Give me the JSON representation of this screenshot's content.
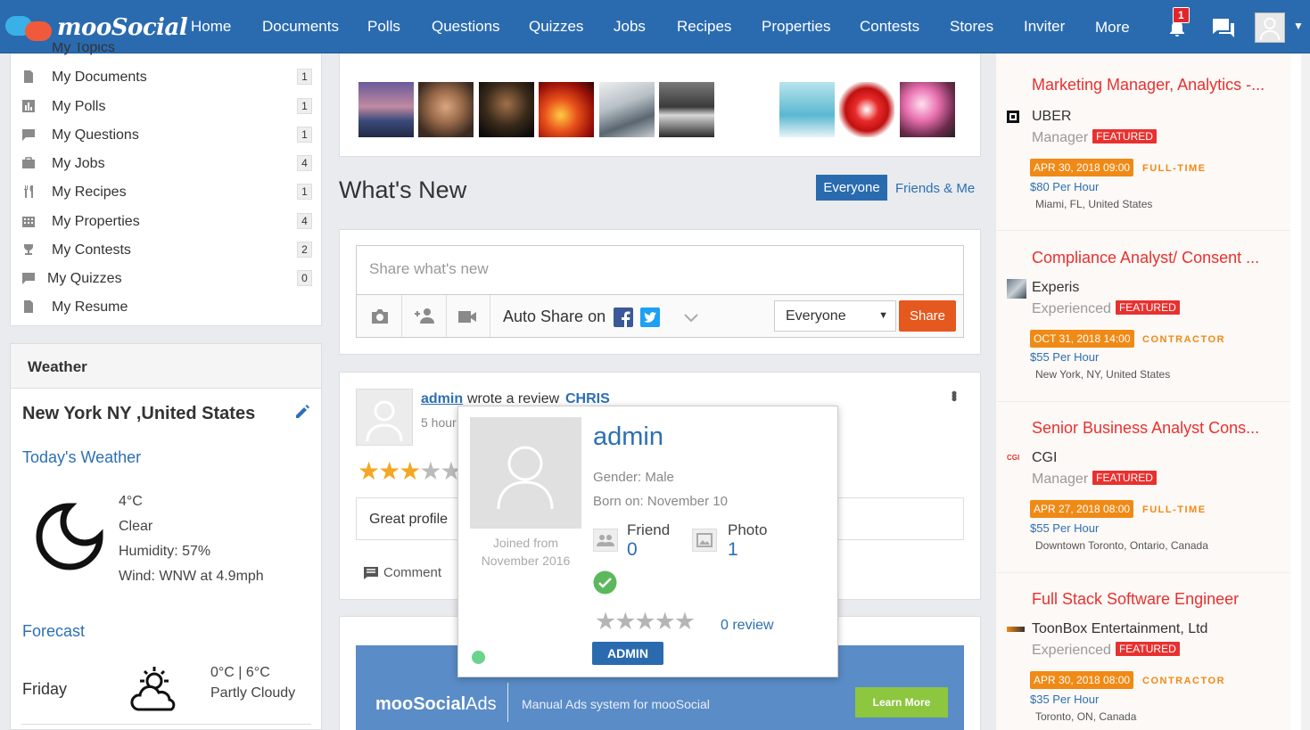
{
  "app": {
    "name": "mooSocial"
  },
  "nav": {
    "items": [
      "Home",
      "Documents",
      "Polls",
      "Questions",
      "Quizzes",
      "Jobs",
      "Recipes",
      "Properties",
      "Contests",
      "Stores",
      "Inviter",
      "More"
    ],
    "notification_count": "1"
  },
  "sidebar": {
    "partial_item": "My Topics",
    "items": [
      {
        "label": "My Documents",
        "count": "1",
        "icon": "document-icon"
      },
      {
        "label": "My Polls",
        "count": "1",
        "icon": "poll-icon"
      },
      {
        "label": "My Questions",
        "count": "1",
        "icon": "question-icon"
      },
      {
        "label": "My Jobs",
        "count": "4",
        "icon": "briefcase-icon"
      },
      {
        "label": "My Recipes",
        "count": "1",
        "icon": "fork-knife-icon"
      },
      {
        "label": "My Properties",
        "count": "4",
        "icon": "building-icon"
      },
      {
        "label": "My Contests",
        "count": "2",
        "icon": "trophy-icon"
      },
      {
        "label": "My Quizzes",
        "count": "0",
        "icon": "quiz-icon"
      },
      {
        "label": "My Resume",
        "count": "",
        "icon": "resume-icon"
      }
    ]
  },
  "weather": {
    "heading": "Weather",
    "location": "New York NY ,United States",
    "today_label": "Today's Weather",
    "temp": "4°C",
    "condition": "Clear",
    "humidity": "Humidity: 57%",
    "wind": "Wind: WNW at 4.9mph",
    "forecast_label": "Forecast",
    "forecast_day": "Friday",
    "forecast_temp": "0°C | 6°C",
    "forecast_condition": "Partly Cloudy"
  },
  "feed": {
    "title": "What's New",
    "tab_everyone": "Everyone",
    "tab_friends": "Friends & Me",
    "share_placeholder": "Share what's new",
    "auto_share": "Auto Share on",
    "privacy_value": "Everyone",
    "share_button": "Share",
    "post": {
      "author": "admin",
      "action": "wrote a review",
      "target": "CHRIS",
      "time": "5 hours ago",
      "rating": 3,
      "review_text": "Great profile",
      "comment_label": "Comment"
    },
    "ad": {
      "brand": "mooSocialAds",
      "brand_bold": "mooSocial",
      "brand_light": "Ads",
      "tagline": "Manual Ads system for mooSocial",
      "cta": "Learn More"
    }
  },
  "popup": {
    "name": "admin",
    "gender": "Gender: Male",
    "born": "Born on: November 10",
    "joined_line1": "Joined from",
    "joined_line2": "November 2016",
    "friend_label": "Friend",
    "friend_count": "0",
    "photo_label": "Photo",
    "photo_count": "1",
    "rating": 0,
    "review_label": "0 review",
    "role_badge": "ADMIN"
  },
  "jobs": [
    {
      "title": "Marketing Manager, Analytics -...",
      "company": "UBER",
      "level": "Manager",
      "featured": "FEATURED",
      "date": "APR 30, 2018 09:00",
      "type": "FULL-TIME",
      "pay": "$80 Per Hour",
      "location": "Miami, FL, United States"
    },
    {
      "title": "Compliance Analyst/ Consent ...",
      "company": "Experis",
      "level": "Experienced",
      "featured": "FEATURED",
      "date": "OCT 31, 2018 14:00",
      "type": "CONTRACTOR",
      "pay": "$55 Per Hour",
      "location": "New York, NY, United States"
    },
    {
      "title": "Senior Business Analyst Cons...",
      "company": "CGI",
      "level": "Manager",
      "featured": "FEATURED",
      "date": "APR 27, 2018 08:00",
      "type": "FULL-TIME",
      "pay": "$55 Per Hour",
      "location": "Downtown Toronto, Ontario, Canada"
    },
    {
      "title": "Full Stack Software Engineer",
      "company": "ToonBox Entertainment, Ltd",
      "level": "Experienced",
      "featured": "FEATURED",
      "date": "APR 30, 2018 08:00",
      "type": "CONTRACTOR",
      "pay": "$35 Per Hour",
      "location": "Toronto, ON, Canada"
    }
  ],
  "colors": {
    "nav": "#2a6bb0",
    "accent": "#2d6fb4",
    "danger": "#e8312f",
    "orange": "#f08a16",
    "share": "#e5581e"
  }
}
